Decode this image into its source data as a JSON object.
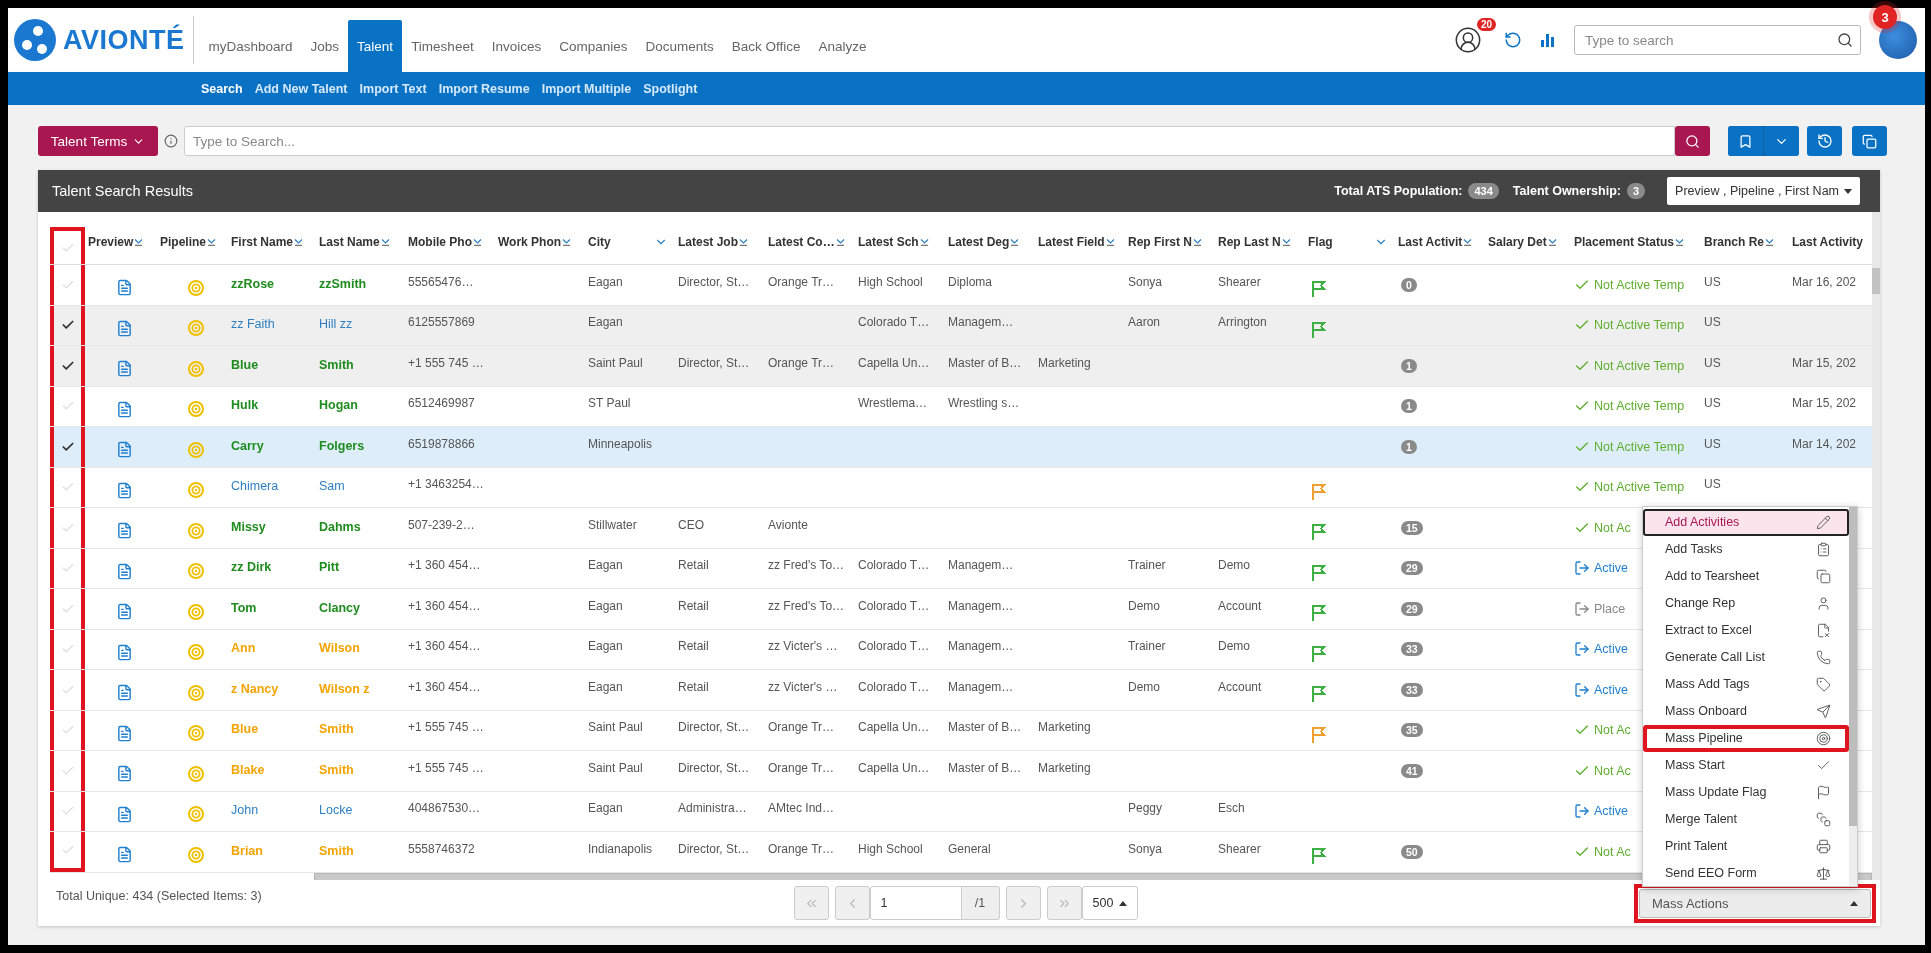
{
  "app": {
    "brand": "AVIONTÉ",
    "nav": [
      {
        "label": "myDashboard",
        "selected": false
      },
      {
        "label": "Jobs",
        "selected": false
      },
      {
        "label": "Talent",
        "selected": true
      },
      {
        "label": "Timesheet",
        "selected": false
      },
      {
        "label": "Invoices",
        "selected": false
      },
      {
        "label": "Companies",
        "selected": false
      },
      {
        "label": "Documents",
        "selected": false
      },
      {
        "label": "Back Office",
        "selected": false
      },
      {
        "label": "Analyze",
        "selected": false
      }
    ],
    "notifications_badge": "20",
    "search_placeholder": "Type to search",
    "avatar_badge": "3"
  },
  "subnav": [
    {
      "label": "Search",
      "selected": true
    },
    {
      "label": "Add New Talent",
      "selected": false
    },
    {
      "label": "Import Text",
      "selected": false
    },
    {
      "label": "Import Resume",
      "selected": false
    },
    {
      "label": "Import Multiple",
      "selected": false
    },
    {
      "label": "Spotlight",
      "selected": false
    }
  ],
  "search_bar": {
    "terms_button": "Talent Terms",
    "placeholder": "Type to Search..."
  },
  "results": {
    "title": "Talent Search Results",
    "population_label": "Total ATS Population:",
    "population": "434",
    "ownership_label": "Talent Ownership:",
    "ownership": "3",
    "columns_dropdown": "Preview , Pipeline , First Nam"
  },
  "table": {
    "select_all_checked": false,
    "checkbox_column_highlighted": true,
    "columns": [
      {
        "label": "Preview",
        "kind": "sort"
      },
      {
        "label": "Pipeline",
        "kind": "sort"
      },
      {
        "label": "First Name",
        "kind": "sort"
      },
      {
        "label": "Last Name",
        "kind": "sort"
      },
      {
        "label": "Mobile Pho",
        "kind": "sort"
      },
      {
        "label": "Work Phon",
        "kind": "sort"
      },
      {
        "label": "City",
        "kind": "dropdown"
      },
      {
        "label": "Latest Job",
        "kind": "sort"
      },
      {
        "label": "Latest Co…",
        "kind": "sort"
      },
      {
        "label": "Latest Sch",
        "kind": "sort"
      },
      {
        "label": "Latest Deg",
        "kind": "sort"
      },
      {
        "label": "Latest Field",
        "kind": "sort"
      },
      {
        "label": "Rep First N",
        "kind": "sort"
      },
      {
        "label": "Rep Last N",
        "kind": "sort"
      },
      {
        "label": "Flag",
        "kind": "dropdown"
      },
      {
        "label": "Last Activit",
        "kind": "sort"
      },
      {
        "label": "Salary Det",
        "kind": "sort"
      },
      {
        "label": "Placement Status",
        "kind": "sort"
      },
      {
        "label": "Branch Re",
        "kind": "sort"
      },
      {
        "label": "Last Activity",
        "kind": "plain"
      }
    ],
    "rows": [
      {
        "checked": false,
        "focused": false,
        "color": "#1e8c1e",
        "bold": true,
        "first": "zzRose",
        "last": "zzSmith",
        "mobile": "55565476…",
        "city": "Eagan",
        "job": "Director, St…",
        "company": "Orange Tr…",
        "school": "High School",
        "degree": "Diploma",
        "rep_first": "Sonya",
        "rep_last": "Shearer",
        "flag": {
          "color": "#3cb043"
        },
        "activity": "0",
        "placement": {
          "kind": "not_active",
          "text": "Not Active Temp"
        },
        "branch": "US",
        "last_activity": "Mar 16, 202"
      },
      {
        "checked": true,
        "focused": false,
        "color": "#2d7fc1",
        "bold": false,
        "first": "zz Faith",
        "last": "Hill zz",
        "mobile": "6125557869",
        "city": "Eagan",
        "school": "Colorado T…",
        "degree": "Managem…",
        "rep_first": "Aaron",
        "rep_last": "Arrington",
        "flag": {
          "color": "#3cb043"
        },
        "placement": {
          "kind": "not_active",
          "text": "Not Active Temp"
        },
        "branch": "US"
      },
      {
        "checked": true,
        "focused": false,
        "color": "#1e8c1e",
        "bold": true,
        "first": "Blue",
        "last": "Smith",
        "mobile": "+1 555 745 …",
        "city": "Saint Paul",
        "job": "Director, St…",
        "company": "Orange Tr…",
        "school": "Capella Un…",
        "degree": "Master of B…",
        "field": "Marketing",
        "activity": "1",
        "placement": {
          "kind": "not_active",
          "text": "Not Active Temp"
        },
        "branch": "US",
        "last_activity": "Mar 15, 202"
      },
      {
        "checked": false,
        "focused": false,
        "color": "#1e8c1e",
        "bold": true,
        "first": "Hulk",
        "last": "Hogan",
        "mobile": "6512469987",
        "city": "ST Paul",
        "school": "Wrestlema…",
        "degree": "Wrestling s…",
        "activity": "1",
        "placement": {
          "kind": "not_active",
          "text": "Not Active Temp"
        },
        "branch": "US",
        "last_activity": "Mar 15, 202"
      },
      {
        "checked": true,
        "focused": true,
        "color": "#1e8c1e",
        "bold": true,
        "first": "Carry",
        "last": "Folgers",
        "mobile": "6519878866",
        "city": "Minneapolis",
        "activity": "1",
        "placement": {
          "kind": "not_active",
          "text": "Not Active Temp"
        },
        "branch": "US",
        "last_activity": "Mar 14, 202"
      },
      {
        "checked": false,
        "focused": false,
        "color": "#2d7fc1",
        "bold": false,
        "first": "Chimera",
        "last": "Sam",
        "mobile": "+1 3463254…",
        "flag": {
          "color": "#f0a030"
        },
        "placement": {
          "kind": "not_active",
          "text": "Not Active Temp"
        },
        "branch": "US"
      },
      {
        "checked": false,
        "focused": false,
        "color": "#1e8c1e",
        "bold": true,
        "first": "Missy",
        "last": "Dahms",
        "mobile": "507-239-2…",
        "city": "Stillwater",
        "job": "CEO",
        "company": "Avionte",
        "flag": {
          "color": "#3cb043"
        },
        "activity": "15",
        "placement": {
          "kind": "not_active",
          "text": "Not Ac"
        }
      },
      {
        "checked": false,
        "focused": false,
        "color": "#1e8c1e",
        "bold": true,
        "first": "zz Dirk",
        "last": "Pitt",
        "mobile": "+1 360 454…",
        "city": "Eagan",
        "job": "Retail",
        "company": "zz Fred's To…",
        "school": "Colorado T…",
        "degree": "Managem…",
        "rep_first": "Trainer",
        "rep_last": "Demo",
        "flag": {
          "color": "#3cb043"
        },
        "activity": "29",
        "placement": {
          "kind": "active",
          "text": "Active"
        }
      },
      {
        "checked": false,
        "focused": false,
        "color": "#1e8c1e",
        "bold": true,
        "first": "Tom",
        "last": "Clancy",
        "mobile": "+1 360 454…",
        "city": "Eagan",
        "job": "Retail",
        "company": "zz Fred's To…",
        "school": "Colorado T…",
        "degree": "Managem…",
        "rep_first": "Demo",
        "rep_last": "Account",
        "flag": {
          "color": "#3cb043"
        },
        "activity": "29",
        "placement": {
          "kind": "placed",
          "text": "Place"
        }
      },
      {
        "checked": false,
        "focused": false,
        "color": "#f5a300",
        "bold": true,
        "first": "Ann",
        "last": "Wilson",
        "mobile": "+1 360 454…",
        "city": "Eagan",
        "job": "Retail",
        "company": "zz Victer's …",
        "school": "Colorado T…",
        "degree": "Managem…",
        "rep_first": "Trainer",
        "rep_last": "Demo",
        "flag": {
          "color": "#3cb043"
        },
        "activity": "33",
        "placement": {
          "kind": "active",
          "text": "Active"
        }
      },
      {
        "checked": false,
        "focused": false,
        "color": "#f5a300",
        "bold": true,
        "first": "z Nancy",
        "last": "Wilson z",
        "mobile": "+1 360 454…",
        "city": "Eagan",
        "job": "Retail",
        "company": "zz Victer's …",
        "school": "Colorado T…",
        "degree": "Managem…",
        "rep_first": "Demo",
        "rep_last": "Account",
        "flag": {
          "color": "#3cb043"
        },
        "activity": "33",
        "placement": {
          "kind": "active",
          "text": "Active"
        }
      },
      {
        "checked": false,
        "focused": false,
        "color": "#f5a300",
        "bold": true,
        "first": "Blue",
        "last": "Smith",
        "mobile": "+1 555 745 …",
        "city": "Saint Paul",
        "job": "Director, St…",
        "company": "Orange Tr…",
        "school": "Capella Un…",
        "degree": "Master of B…",
        "field": "Marketing",
        "flag": {
          "color": "#f0a030"
        },
        "activity": "35",
        "placement": {
          "kind": "not_active",
          "text": "Not Ac"
        }
      },
      {
        "checked": false,
        "focused": false,
        "color": "#f5a300",
        "bold": true,
        "first": "Blake",
        "last": "Smith",
        "mobile": "+1 555 745 …",
        "city": "Saint Paul",
        "job": "Director, St…",
        "company": "Orange Tr…",
        "school": "Capella Un…",
        "degree": "Master of B…",
        "field": "Marketing",
        "activity": "41",
        "placement": {
          "kind": "not_active",
          "text": "Not Ac"
        }
      },
      {
        "checked": false,
        "focused": false,
        "color": "#2d7fc1",
        "bold": false,
        "first": "John",
        "last": "Locke",
        "mobile": "404867530…",
        "city": "Eagan",
        "job": "Administra…",
        "company": "AMtec Ind…",
        "rep_first": "Peggy",
        "rep_last": "Esch",
        "placement": {
          "kind": "active",
          "text": "Active"
        }
      },
      {
        "checked": false,
        "focused": false,
        "color": "#f5a300",
        "bold": true,
        "first": "Brian",
        "last": "Smith",
        "mobile": "5558746372",
        "city": "Indianapolis",
        "job": "Director, St…",
        "company": "Orange Tr…",
        "school": "High School",
        "degree": "General",
        "rep_first": "Sonya",
        "rep_last": "Shearer",
        "flag": {
          "color": "#3cb043"
        },
        "activity": "50",
        "placement": {
          "kind": "not_active",
          "text": "Not Ac"
        }
      }
    ]
  },
  "footer": {
    "total": "Total Unique: 434 (Selected Items: 3)",
    "page": "1",
    "page_count": "/1",
    "page_size": "500"
  },
  "mass_actions": {
    "label": "Mass Actions",
    "highlighted": true,
    "expanded": true,
    "menu": [
      {
        "label": "Add Activities",
        "selected": true,
        "highlighted": false
      },
      {
        "label": "Add Tasks",
        "selected": false,
        "highlighted": false
      },
      {
        "label": "Add to Tearsheet",
        "selected": false,
        "highlighted": false
      },
      {
        "label": "Change Rep",
        "selected": false,
        "highlighted": false
      },
      {
        "label": "Extract to Excel",
        "selected": false,
        "highlighted": false
      },
      {
        "label": "Generate Call List",
        "selected": false,
        "highlighted": false
      },
      {
        "label": "Mass Add Tags",
        "selected": false,
        "highlighted": false
      },
      {
        "label": "Mass Onboard",
        "selected": false,
        "highlighted": false
      },
      {
        "label": "Mass Pipeline",
        "selected": false,
        "highlighted": true
      },
      {
        "label": "Mass Start",
        "selected": false,
        "highlighted": false
      },
      {
        "label": "Mass Update Flag",
        "selected": false,
        "highlighted": false
      },
      {
        "label": "Merge Talent",
        "selected": false,
        "highlighted": false
      },
      {
        "label": "Print Talent",
        "selected": false,
        "highlighted": false
      },
      {
        "label": "Send EEO Form",
        "selected": false,
        "highlighted": false
      }
    ]
  }
}
